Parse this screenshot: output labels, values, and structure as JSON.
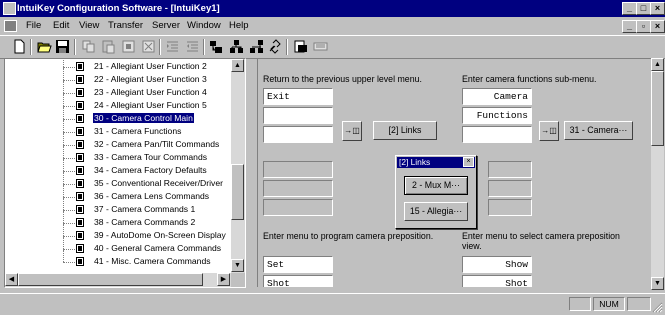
{
  "window": {
    "title": "IntuiKey Configuration Software - [IntuiKey1]",
    "controls": [
      "_",
      "□",
      "×"
    ],
    "mdi_controls": [
      "_",
      "▫",
      "×"
    ]
  },
  "menu": {
    "items": [
      "File",
      "Edit",
      "View",
      "Transfer",
      "Server",
      "Window",
      "Help"
    ]
  },
  "toolbar": {
    "buttons": [
      "new-icon",
      "open-icon",
      "save-icon",
      "copy-icon",
      "paste-icon",
      "cut-icon",
      "clear-icon",
      "indent-icon",
      "outdent-icon",
      "tree-add-icon",
      "tree-insert-icon",
      "tree-move-icon",
      "link-icon",
      "print-icon",
      "keyboard-icon"
    ]
  },
  "tree": {
    "items": [
      {
        "label": "21 - Allegiant User Function 2",
        "selected": false
      },
      {
        "label": "22 - Allegiant User Function 3",
        "selected": false
      },
      {
        "label": "23 - Allegiant User Function 4",
        "selected": false
      },
      {
        "label": "24 - Allegiant User Function 5",
        "selected": false
      },
      {
        "label": "30 - Camera Control Main",
        "selected": true
      },
      {
        "label": "31 - Camera Functions",
        "selected": false
      },
      {
        "label": "32 - Camera Pan/Tilt Commands",
        "selected": false
      },
      {
        "label": "33 - Camera Tour Commands",
        "selected": false
      },
      {
        "label": "34 - Camera Factory Defaults",
        "selected": false
      },
      {
        "label": "35 - Conventional Receiver/Driver",
        "selected": false
      },
      {
        "label": "36 - Camera Lens Commands",
        "selected": false
      },
      {
        "label": "37 - Camera Commands 1",
        "selected": false
      },
      {
        "label": "38 - Camera Commands 2",
        "selected": false
      },
      {
        "label": "39 - AutoDome On-Screen Display",
        "selected": false
      },
      {
        "label": "40 - General Camera Commands",
        "selected": false
      },
      {
        "label": "41 - Misc. Camera Commands",
        "selected": false
      }
    ]
  },
  "editor": {
    "left_desc_top": "Return to the previous upper level menu.",
    "right_desc_top": "Enter camera functions sub-menu.",
    "left_field_1": "Exit",
    "right_field_1": "Camera",
    "right_field_2": "Functions",
    "link_button_left": "[2] Links",
    "link_button_right": "31 - Camera···",
    "link_icon": "→◫",
    "left_desc_bottom": "Enter menu to program camera preposition.",
    "right_desc_bottom_1": "Enter menu to select camera preposition",
    "right_desc_bottom_2": "view.",
    "left_field_bottom_1": "Set",
    "left_field_bottom_2": "Shot",
    "right_field_bottom_1": "Show",
    "right_field_bottom_2": "Shot"
  },
  "popup": {
    "title": "[2] Links",
    "close": "×",
    "items": [
      "2 - Mux M···",
      "15 - Allegia···"
    ]
  },
  "statusbar": {
    "num": "NUM"
  }
}
